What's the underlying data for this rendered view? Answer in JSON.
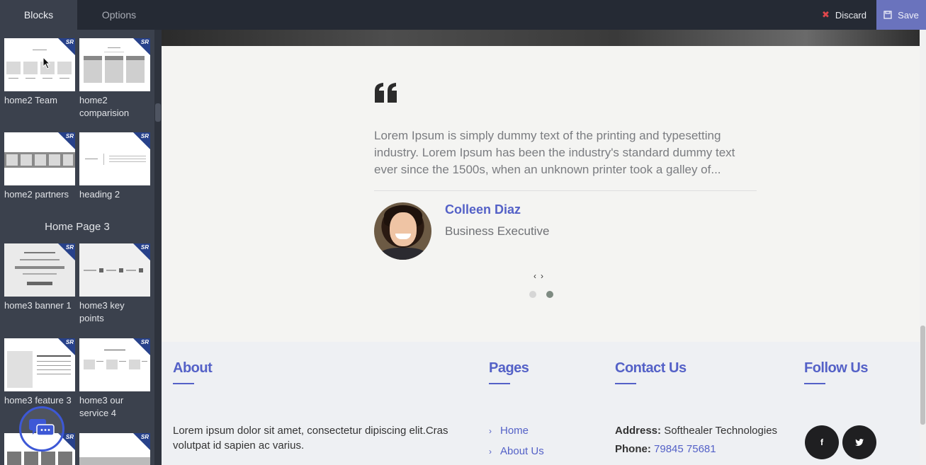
{
  "topbar": {
    "tabs": [
      {
        "label": "Blocks"
      },
      {
        "label": "Options"
      }
    ],
    "discard_label": "Discard",
    "save_label": "Save"
  },
  "sidebar": {
    "badge": "SR",
    "blocks": [
      {
        "label": "home2 Team"
      },
      {
        "label": "home2 comparision"
      },
      {
        "label": "home2 partners"
      },
      {
        "label": "heading 2"
      },
      {
        "label": "home3 banner 1"
      },
      {
        "label": "home3 key points"
      },
      {
        "label": "home3 feature 3"
      },
      {
        "label": "home3 our service 4"
      }
    ],
    "section_title": "Home Page 3"
  },
  "testimonial": {
    "quote": "Lorem Ipsum is simply dummy text of the printing and typesetting industry. Lorem Ipsum has been the industry's standard dummy text ever since the 1500s, when an unknown printer took a galley of...",
    "name": "Colleen Diaz",
    "role": "Business Executive",
    "prev": "‹",
    "next": "›",
    "active_slide": 2,
    "slide_count": 2
  },
  "footer": {
    "about": {
      "heading": "About",
      "text": "Lorem ipsum dolor sit amet, consectetur dipiscing elit.Cras volutpat id sapien ac varius."
    },
    "pages": {
      "heading": "Pages",
      "links": [
        {
          "label": "Home"
        },
        {
          "label": "About Us"
        }
      ]
    },
    "contact": {
      "heading": "Contact Us",
      "address_label": "Address:",
      "address_value": "Softhealer Technologies",
      "phone_label": "Phone:",
      "phone_value": "79845 75681"
    },
    "follow": {
      "heading": "Follow Us",
      "icons": [
        {
          "glyph": "f",
          "name": "facebook-icon"
        },
        {
          "glyph": "🐦",
          "name": "twitter-icon"
        }
      ]
    }
  },
  "colors": {
    "accent": "#5461c7",
    "topbar": "#252a34",
    "sidebar": "#3b414d",
    "discard": "#e0474c",
    "save": "#6a73bd"
  }
}
